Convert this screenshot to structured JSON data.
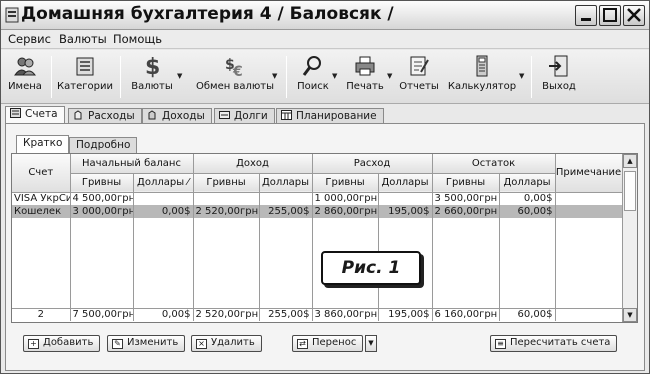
{
  "window": {
    "title": "Домашняя бухгалтерия 4  / Баловсяк /"
  },
  "menu": [
    "Сервис",
    "Валюты",
    "Помощь"
  ],
  "toolbar": {
    "names": "Имена",
    "categories": "Категории",
    "currencies": "Валюты",
    "exchange": "Обмен валюты",
    "search": "Поиск",
    "print": "Печать",
    "reports": "Отчеты",
    "calculator": "Калькулятор",
    "exit": "Выход"
  },
  "main_tabs": [
    "Счета",
    "Расходы",
    "Доходы",
    "Долги",
    "Планирование"
  ],
  "sub_tabs": [
    "Кратко",
    "Подробно"
  ],
  "table": {
    "headers": {
      "account": "Счет",
      "start": "Начальный баланс",
      "income": "Доход",
      "expense": "Расход",
      "balance": "Остаток",
      "note": "Примечание",
      "uah": "Гривны",
      "usd": "Доллары",
      "usd_sorted": "Доллары ⁄"
    },
    "rows": [
      [
        "VISA УкрСи",
        "4 500,00грн",
        "",
        "",
        "",
        "1 000,00грн",
        "",
        "3 500,00грн",
        "0,00$",
        ""
      ],
      [
        "Кошелек",
        "3 000,00грн",
        "0,00$",
        "2 520,00грн",
        "255,00$",
        "2 860,00грн",
        "195,00$",
        "2 660,00грн",
        "60,00$",
        ""
      ]
    ],
    "total": [
      "2",
      "7 500,00грн",
      "0,00$",
      "2 520,00грн",
      "255,00$",
      "3 860,00грн",
      "195,00$",
      "6 160,00грн",
      "60,00$",
      ""
    ]
  },
  "figure_label": "Рис. 1",
  "buttons": {
    "add": "Добавить",
    "edit": "Изменить",
    "delete": "Удалить",
    "transfer": "Перенос",
    "recalc": "Пересчитать счета"
  }
}
